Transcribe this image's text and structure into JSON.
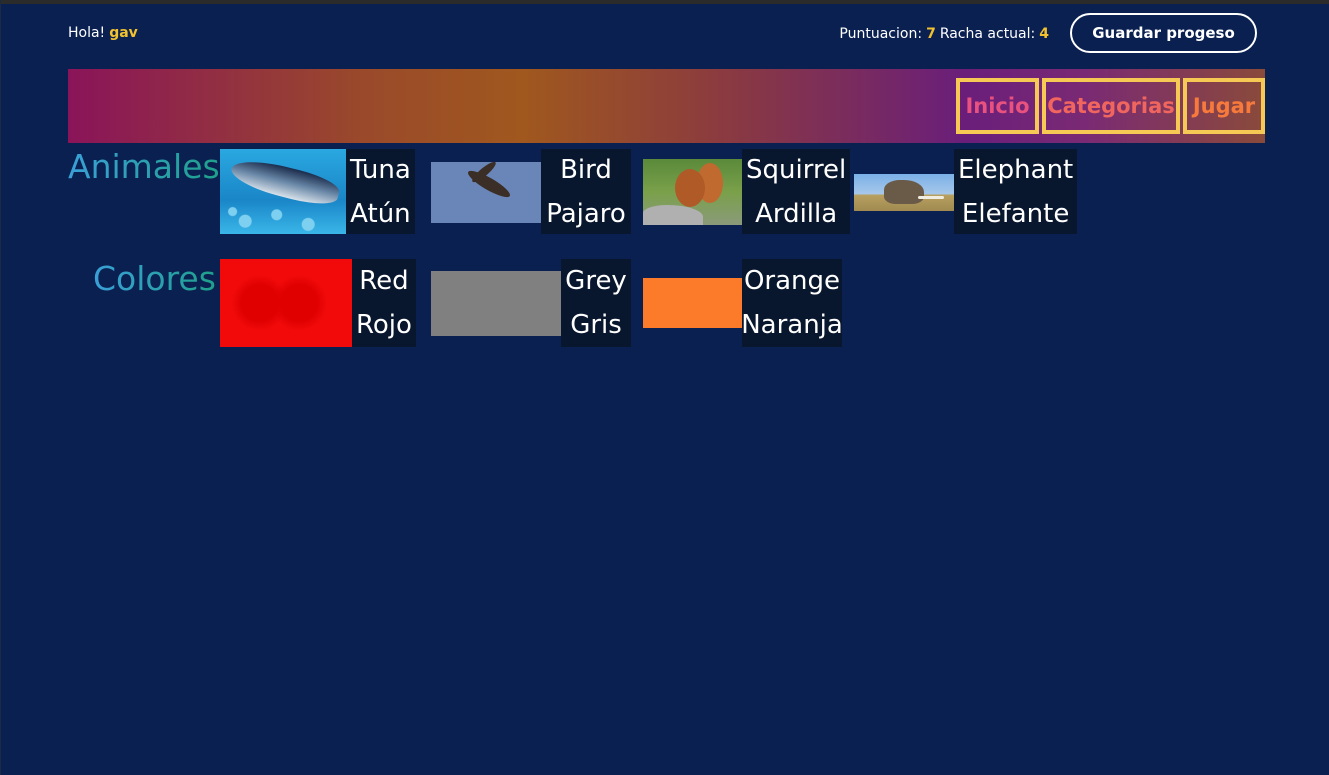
{
  "header": {
    "greeting": "Hola!",
    "username": "gav",
    "score_label": "Puntuacion:",
    "score_value": "7",
    "streak_label": "Racha actual:",
    "streak_value": "4",
    "save_button": "Guardar progeso"
  },
  "nav": {
    "items": [
      {
        "label": "Inicio"
      },
      {
        "label": "Categorias"
      },
      {
        "label": "Jugar"
      }
    ]
  },
  "categories": [
    {
      "name": "Animales",
      "cards": [
        {
          "english": "Tuna",
          "spanish": "Atún",
          "image": "tuna-photo"
        },
        {
          "english": "Bird",
          "spanish": "Pajaro",
          "image": "bird-photo"
        },
        {
          "english": "Squirrel",
          "spanish": "Ardilla",
          "image": "squirrel-photo"
        },
        {
          "english": "Elephant",
          "spanish": "Elefante",
          "image": "elephant-photo"
        }
      ]
    },
    {
      "name": "Colores",
      "cards": [
        {
          "english": "Red",
          "spanish": "Rojo",
          "swatch": "#f20a0a"
        },
        {
          "english": "Grey",
          "spanish": "Gris",
          "swatch": "#808080"
        },
        {
          "english": "Orange",
          "spanish": "Naranja",
          "swatch": "#fb7b2a"
        }
      ]
    }
  ],
  "colors": {
    "background": "#0a2050",
    "accent": "#f2c12e",
    "nav_border": "#f6c955"
  }
}
